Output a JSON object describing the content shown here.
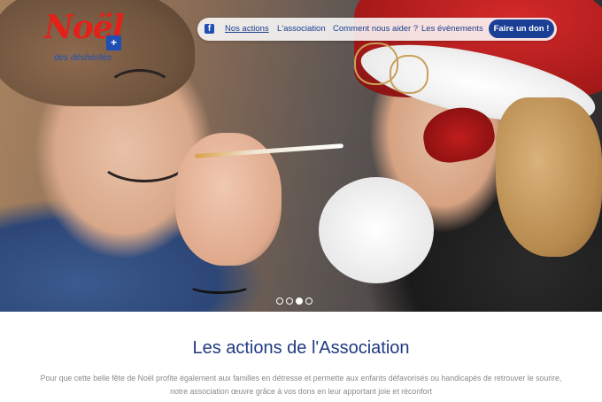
{
  "brand": {
    "logo_main": "Noël",
    "logo_badge": "+",
    "logo_sub": "des déshérités"
  },
  "nav": {
    "facebook_icon": "f",
    "items": [
      {
        "label": "Nos actions",
        "active": true
      },
      {
        "label": "L'association",
        "active": false
      },
      {
        "label": "Comment nous aider ?",
        "active": false
      },
      {
        "label": "Les évènements",
        "active": false
      }
    ],
    "cta_label": "Faire un don !"
  },
  "carousel": {
    "slides_count": 4,
    "active_index": 2
  },
  "section": {
    "title": "Les actions de l'Association",
    "text": "Pour que cette belle fête de Noël profite également aux familles en détresse et permette aux enfants défavorisés ou handicapés de retrouver le sourire, notre association œuvre grâce à vos dons en leur apportant joie et réconfort"
  },
  "colors": {
    "brand_red": "#e32119",
    "brand_blue": "#1f4fb5",
    "nav_text": "#1a3e8e",
    "cta_bg": "#1c3f96",
    "title": "#1f3a82",
    "body_text": "#8a8a8a"
  },
  "icons": {
    "nav_social": "facebook-icon"
  }
}
